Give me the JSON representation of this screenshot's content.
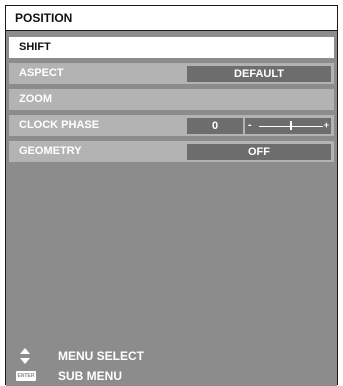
{
  "header": {
    "title": "POSITION"
  },
  "menu": {
    "items": [
      {
        "label": "SHIFT",
        "state": "selected"
      },
      {
        "label": "ASPECT",
        "value": "DEFAULT"
      },
      {
        "label": "ZOOM"
      },
      {
        "label": "CLOCK PHASE",
        "value": "0",
        "slider_minus": "-",
        "slider_plus": "+",
        "slider_level": 0.5
      },
      {
        "label": "GEOMETRY",
        "value": "OFF"
      }
    ]
  },
  "help": {
    "menu_select": {
      "icon": "up-down-arrows-icon",
      "text": "MENU SELECT"
    },
    "sub_menu": {
      "icon": "enter-key-icon",
      "icon_text": "ENTER",
      "text": "SUB MENU"
    }
  },
  "colors": {
    "background": "#8c8c8c",
    "row": "#b3b3b3",
    "value_box": "#6d6d6d",
    "selected": "#ffffff"
  }
}
